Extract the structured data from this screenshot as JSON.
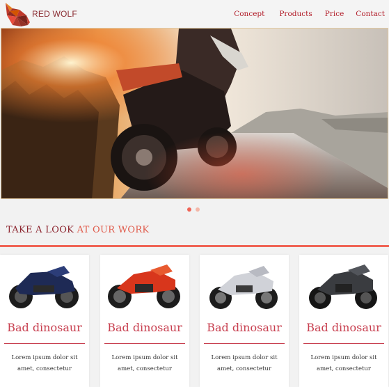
{
  "brand": {
    "name": "RED WOLF"
  },
  "nav": [
    {
      "label": "Concept"
    },
    {
      "label": "Products"
    },
    {
      "label": "Price"
    },
    {
      "label": "Contact"
    }
  ],
  "slider": {
    "active_index": 0,
    "count": 2
  },
  "section": {
    "title_plain": "TAKE A LOOK",
    "title_accent": "AT OUR WORK"
  },
  "cards": [
    {
      "title": "Bad dinosaur",
      "line1": "Lorem ipsum dolor sit",
      "line2": "amet, consectetur",
      "bike_color": "#1e2a55"
    },
    {
      "title": "Bad dinosaur",
      "line1": "Lorem ipsum dolor sit",
      "line2": "amet, consectetur",
      "bike_color": "#d8361c"
    },
    {
      "title": "Bad dinosaur",
      "line1": "Lorem ipsum dolor sit",
      "line2": "amet, consectetur",
      "bike_color": "#d0d2d8"
    },
    {
      "title": "Bad dinosaur",
      "line1": "Lorem ipsum dolor sit",
      "line2": "amet, consectetur",
      "bike_color": "#3a3c40"
    }
  ],
  "colors": {
    "accent": "#f06456",
    "dot_active": "#f06456",
    "dot_inactive": "#f4b7a8"
  }
}
